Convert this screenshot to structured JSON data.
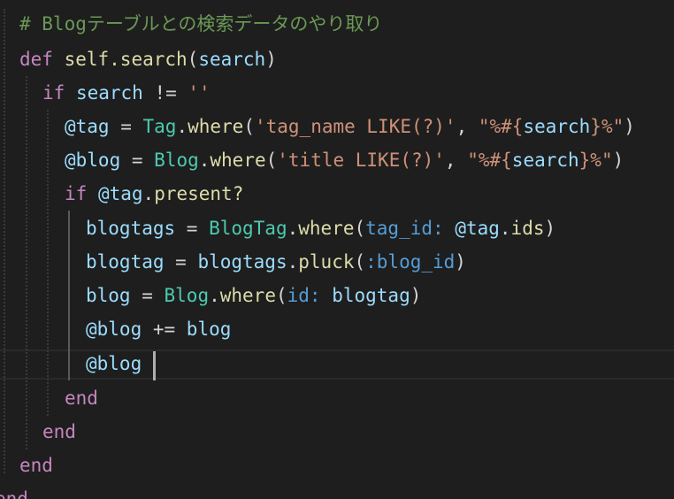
{
  "editor": {
    "language": "ruby",
    "colors": {
      "background": "#1e1e1e",
      "comment": "#6a9955",
      "keyword": "#c586c0",
      "function": "#dcdcaa",
      "variable": "#9cdcfe",
      "string": "#ce9178",
      "constant": "#4ec9b0",
      "symbol": "#569cd6"
    },
    "lines": [
      {
        "t": "comment",
        "v": "# Blogテーブルとの検索データのやり取り"
      },
      {
        "t": "code",
        "tokens": [
          {
            "c": "kw",
            "v": "def"
          },
          {
            "c": "op",
            "v": " "
          },
          {
            "c": "def",
            "v": "self.search"
          },
          {
            "c": "op",
            "v": "("
          },
          {
            "c": "var",
            "v": "search"
          },
          {
            "c": "op",
            "v": ")"
          }
        ]
      },
      {
        "t": "code",
        "tokens": [
          {
            "c": "kw",
            "v": "if"
          },
          {
            "c": "op",
            "v": " "
          },
          {
            "c": "var",
            "v": "search"
          },
          {
            "c": "op",
            "v": " != "
          },
          {
            "c": "str",
            "v": "''"
          }
        ]
      },
      {
        "t": "code",
        "tokens": [
          {
            "c": "var",
            "v": "@tag"
          },
          {
            "c": "op",
            "v": " = "
          },
          {
            "c": "const",
            "v": "Tag"
          },
          {
            "c": "op",
            "v": "."
          },
          {
            "c": "fn",
            "v": "where"
          },
          {
            "c": "op",
            "v": "("
          },
          {
            "c": "str",
            "v": "'tag_name LIKE(?)'"
          },
          {
            "c": "op",
            "v": ", "
          },
          {
            "c": "str",
            "v": "\"%#{"
          },
          {
            "c": "var",
            "v": "search"
          },
          {
            "c": "str",
            "v": "}%\""
          },
          {
            "c": "op",
            "v": ")"
          }
        ]
      },
      {
        "t": "code",
        "tokens": [
          {
            "c": "var",
            "v": "@blog"
          },
          {
            "c": "op",
            "v": " = "
          },
          {
            "c": "const",
            "v": "Blog"
          },
          {
            "c": "op",
            "v": "."
          },
          {
            "c": "fn",
            "v": "where"
          },
          {
            "c": "op",
            "v": "("
          },
          {
            "c": "str",
            "v": "'title LIKE(?)'"
          },
          {
            "c": "op",
            "v": ", "
          },
          {
            "c": "str",
            "v": "\"%#{"
          },
          {
            "c": "var",
            "v": "search"
          },
          {
            "c": "str",
            "v": "}%\""
          },
          {
            "c": "op",
            "v": ")"
          }
        ]
      },
      {
        "t": "code",
        "tokens": [
          {
            "c": "kw",
            "v": "if"
          },
          {
            "c": "op",
            "v": " "
          },
          {
            "c": "var",
            "v": "@tag"
          },
          {
            "c": "op",
            "v": "."
          },
          {
            "c": "fn",
            "v": "present?"
          }
        ]
      },
      {
        "t": "code",
        "tokens": [
          {
            "c": "var",
            "v": "blogtags"
          },
          {
            "c": "op",
            "v": " = "
          },
          {
            "c": "const",
            "v": "BlogTag"
          },
          {
            "c": "op",
            "v": "."
          },
          {
            "c": "fn",
            "v": "where"
          },
          {
            "c": "op",
            "v": "("
          },
          {
            "c": "sym",
            "v": "tag_id:"
          },
          {
            "c": "op",
            "v": " "
          },
          {
            "c": "var",
            "v": "@tag"
          },
          {
            "c": "op",
            "v": "."
          },
          {
            "c": "fn",
            "v": "ids"
          },
          {
            "c": "op",
            "v": ")"
          }
        ]
      },
      {
        "t": "code",
        "tokens": [
          {
            "c": "var",
            "v": "blogtag"
          },
          {
            "c": "op",
            "v": " = "
          },
          {
            "c": "var",
            "v": "blogtags"
          },
          {
            "c": "op",
            "v": "."
          },
          {
            "c": "fn",
            "v": "pluck"
          },
          {
            "c": "op",
            "v": "("
          },
          {
            "c": "sym",
            "v": ":blog_id"
          },
          {
            "c": "op",
            "v": ")"
          }
        ]
      },
      {
        "t": "code",
        "tokens": [
          {
            "c": "var",
            "v": "blog"
          },
          {
            "c": "op",
            "v": " = "
          },
          {
            "c": "const",
            "v": "Blog"
          },
          {
            "c": "op",
            "v": "."
          },
          {
            "c": "fn",
            "v": "where"
          },
          {
            "c": "op",
            "v": "("
          },
          {
            "c": "sym",
            "v": "id:"
          },
          {
            "c": "op",
            "v": " "
          },
          {
            "c": "var",
            "v": "blogtag"
          },
          {
            "c": "op",
            "v": ")"
          }
        ]
      },
      {
        "t": "code",
        "tokens": [
          {
            "c": "var",
            "v": "@blog"
          },
          {
            "c": "op",
            "v": " += "
          },
          {
            "c": "var",
            "v": "blog"
          }
        ]
      },
      {
        "t": "code",
        "tokens": [
          {
            "c": "var",
            "v": "@blog"
          }
        ]
      },
      {
        "t": "code",
        "tokens": [
          {
            "c": "kw",
            "v": "end"
          }
        ]
      },
      {
        "t": "code",
        "tokens": [
          {
            "c": "kw",
            "v": "end"
          }
        ]
      },
      {
        "t": "code",
        "tokens": [
          {
            "c": "kw",
            "v": "end"
          }
        ]
      },
      {
        "t": "code",
        "tokens": [
          {
            "c": "kw",
            "v": "end"
          }
        ]
      }
    ]
  }
}
